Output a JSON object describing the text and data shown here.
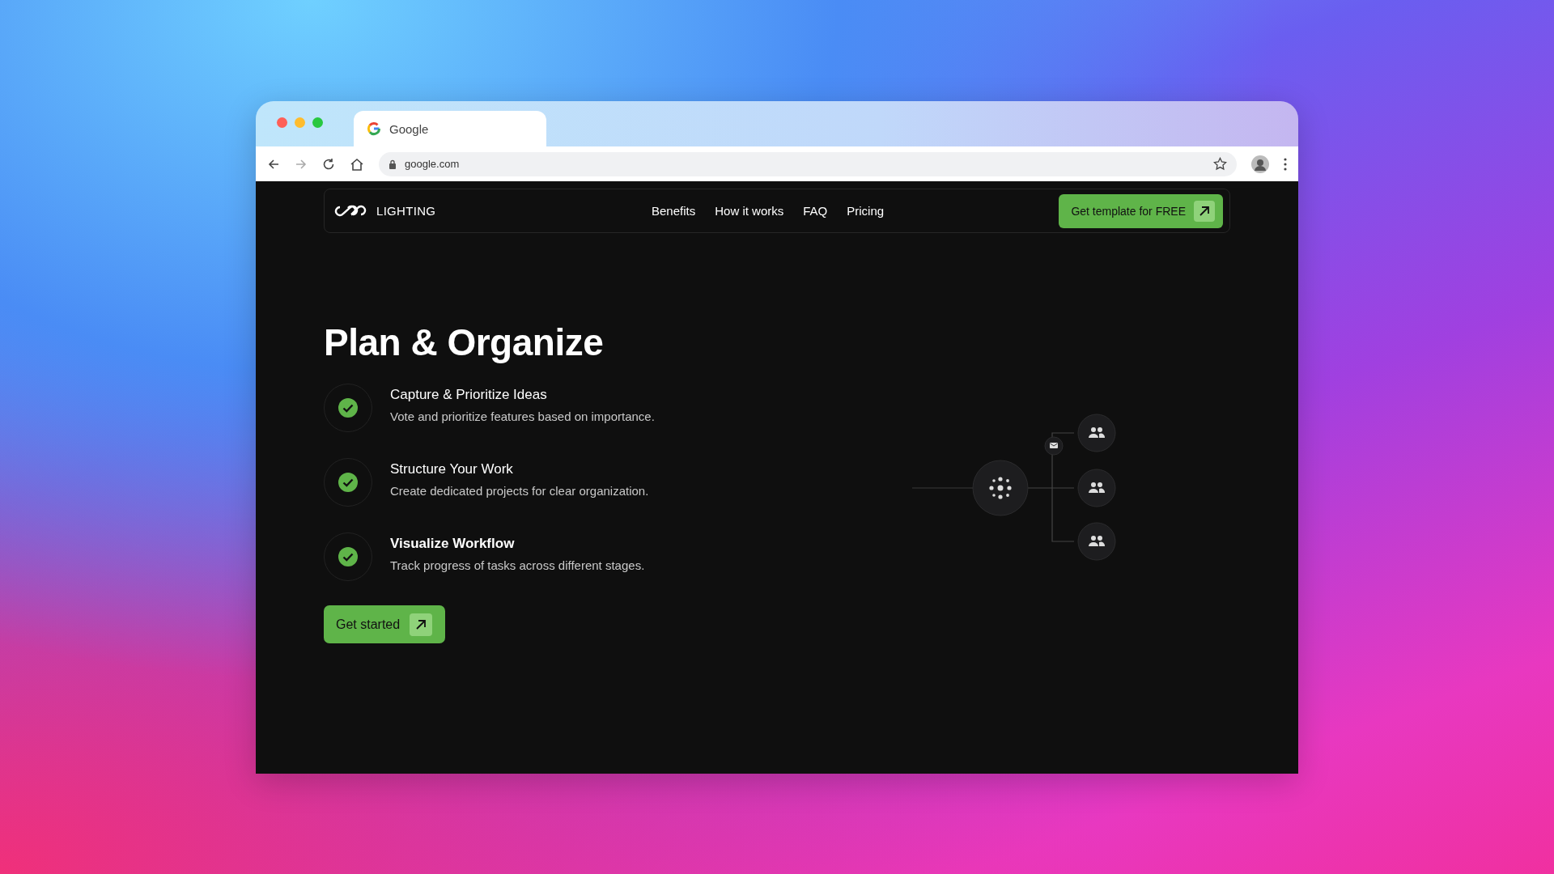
{
  "browser": {
    "tab_title": "Google",
    "address": "google.com"
  },
  "nav": {
    "brand": "LIGHTING",
    "links": [
      "Benefits",
      "How it works",
      "FAQ",
      "Pricing"
    ],
    "cta": "Get template for FREE"
  },
  "hero": {
    "title": "Plan & Organize",
    "features": [
      {
        "title": "Capture & Prioritize Ideas",
        "description": "Vote and prioritize features based on importance.",
        "active": false
      },
      {
        "title": "Structure Your Work",
        "description": "Create dedicated projects for clear organization.",
        "active": false
      },
      {
        "title": "Visualize Workflow",
        "description": "Track progress of tasks across different stages.",
        "active": true
      }
    ],
    "button": "Get started"
  }
}
